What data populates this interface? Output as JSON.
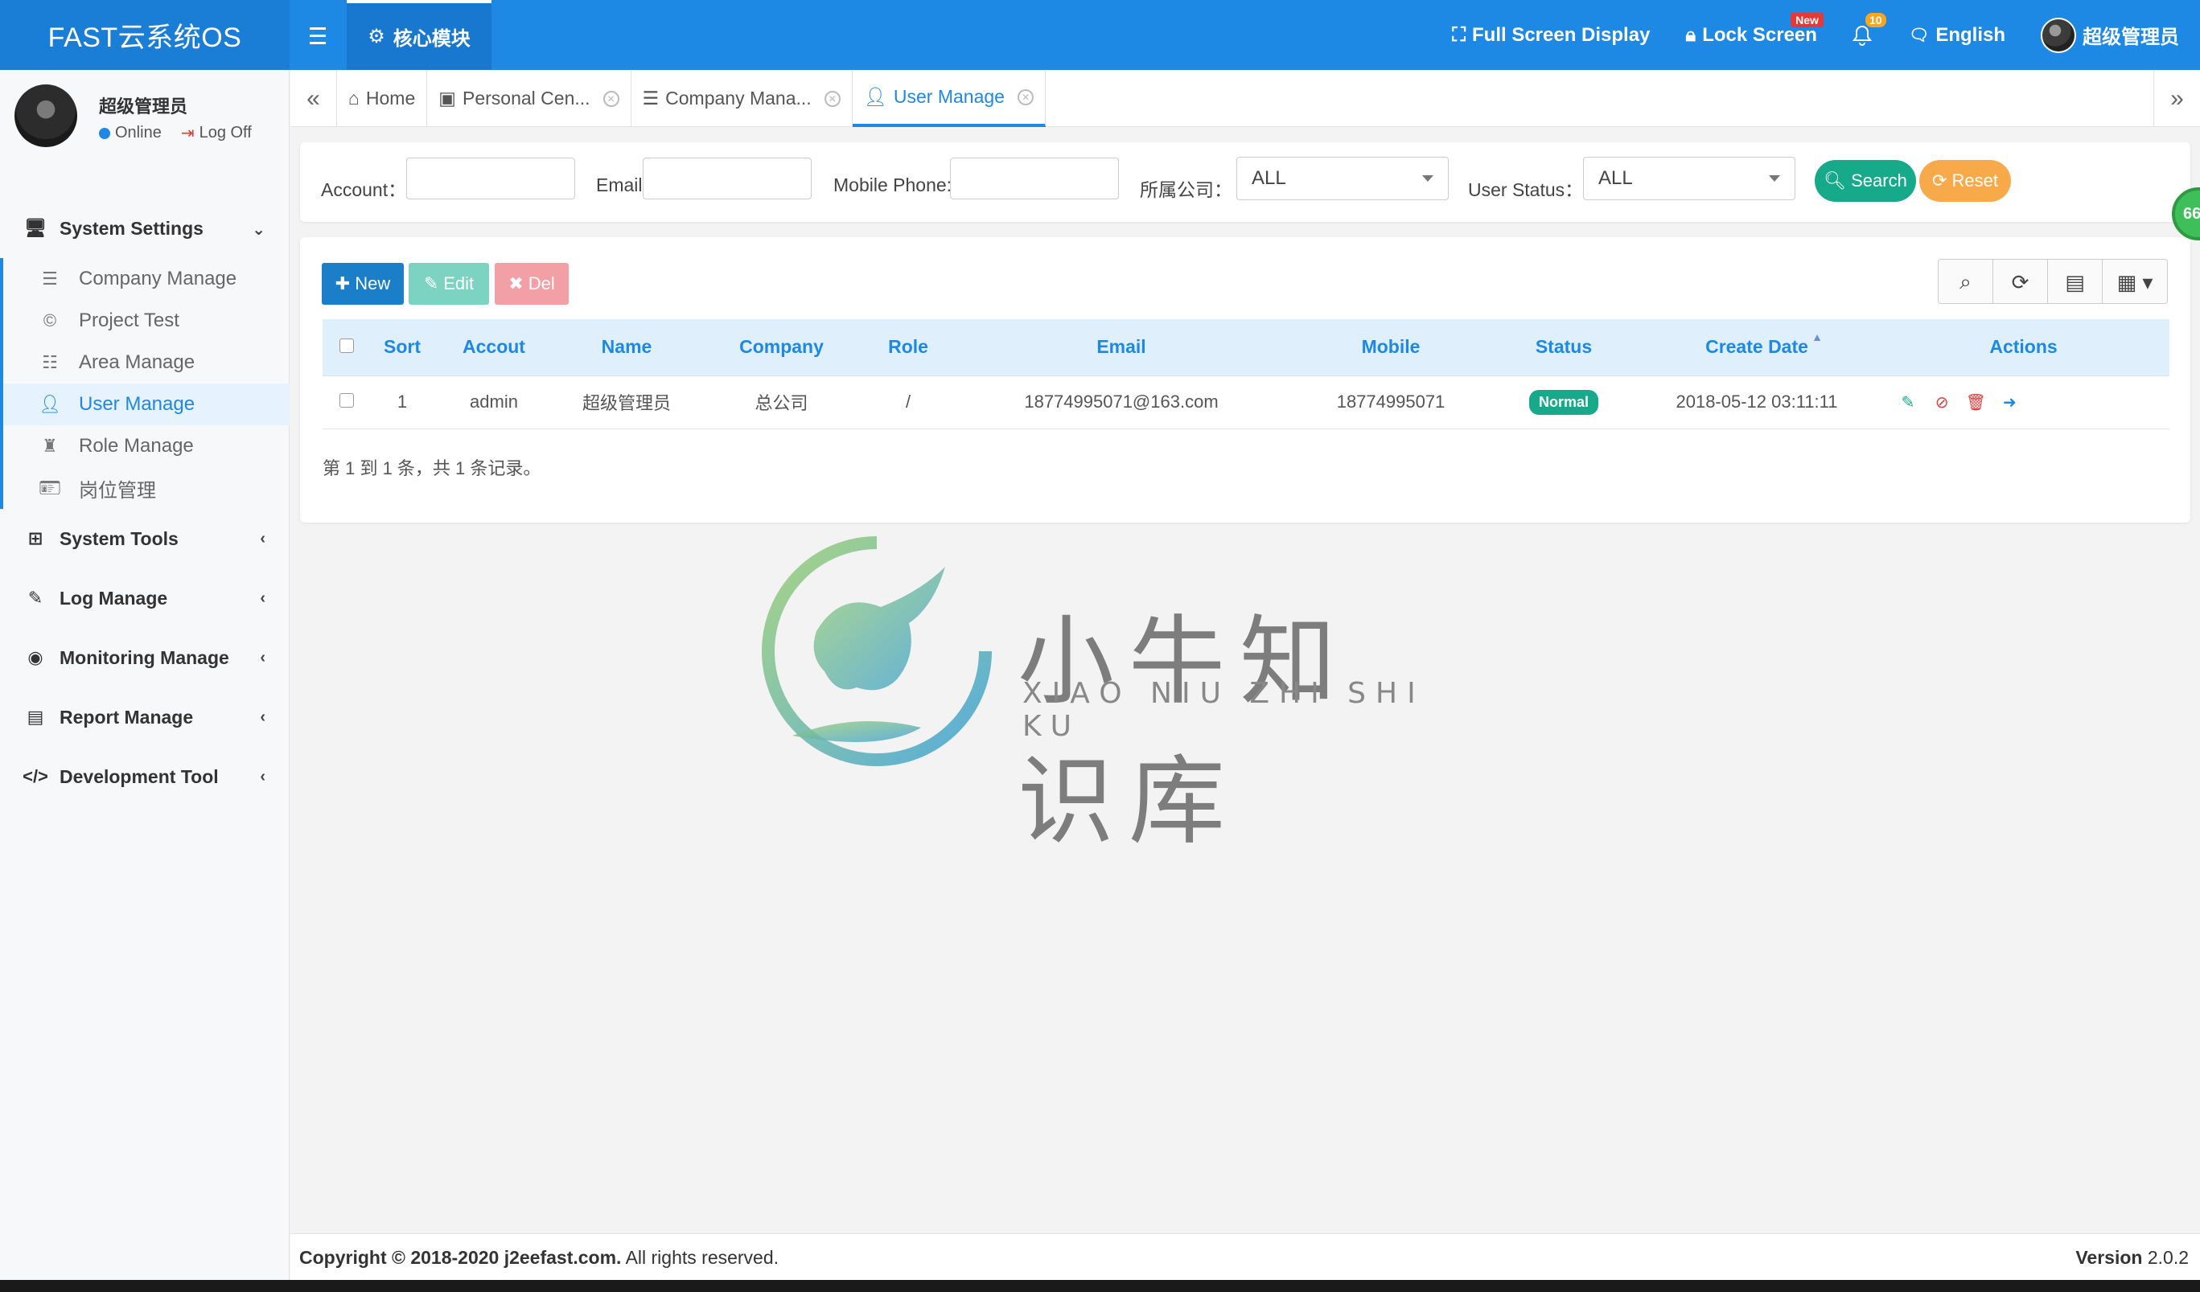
{
  "brand": "FAST云系统OS",
  "module_tab": "核心模块",
  "topbar": {
    "fullscreen": "Full Screen Display",
    "lock": "Lock Screen",
    "lock_badge": "New",
    "notifications_count": "10",
    "language": "English",
    "user": "超级管理员"
  },
  "user_panel": {
    "name": "超级管理员",
    "status": "Online",
    "logoff": "Log Off"
  },
  "nav": {
    "system_settings": "System Settings",
    "sub": [
      "Company Manage",
      "Project Test",
      "Area Manage",
      "User Manage",
      "Role Manage",
      "岗位管理"
    ],
    "system_tools": "System Tools",
    "log_manage": "Log Manage",
    "monitoring": "Monitoring Manage",
    "report": "Report Manage",
    "dev_tool": "Development Tool"
  },
  "tabs": [
    "Home",
    "Personal Cen...",
    "Company Mana...",
    "User Manage"
  ],
  "search": {
    "account_label": "Account：",
    "email_label": "Email:",
    "mobile_label": "Mobile Phone:",
    "company_label": "所属公司：",
    "company_value": "ALL",
    "status_label": "User Status：",
    "status_value": "ALL",
    "search_btn": "Search",
    "reset_btn": "Reset"
  },
  "toolbar": {
    "new": "New",
    "edit": "Edit",
    "del": "Del"
  },
  "table": {
    "headers": [
      "Sort",
      "Accout",
      "Name",
      "Company",
      "Role",
      "Email",
      "Mobile",
      "Status",
      "Create Date",
      "Actions"
    ],
    "rows": [
      {
        "sort": "1",
        "account": "admin",
        "name": "超级管理员",
        "company": "总公司",
        "role": "/",
        "email": "18774995071@163.com",
        "mobile": "18774995071",
        "status": "Normal",
        "create_date": "2018-05-12 03:11:11"
      }
    ],
    "page_info": "第 1 到 1 条，共 1 条记录。"
  },
  "watermark": {
    "title": "小牛知识库",
    "subtitle": "XIAO NIU ZHI SHI KU"
  },
  "float_ball": "66",
  "footer": {
    "copyright_prefix": "Copyright © 2018-2020 j2eefast.com.",
    "copyright_suffix": " All rights reserved.",
    "version_label": "Version",
    "version": "2.0.2"
  },
  "colors": {
    "primary": "#1e88e5",
    "success": "#16a98a",
    "warning": "#f8a94a",
    "danger_light": "#f2a0a6",
    "edit_light": "#7dd3c2"
  }
}
